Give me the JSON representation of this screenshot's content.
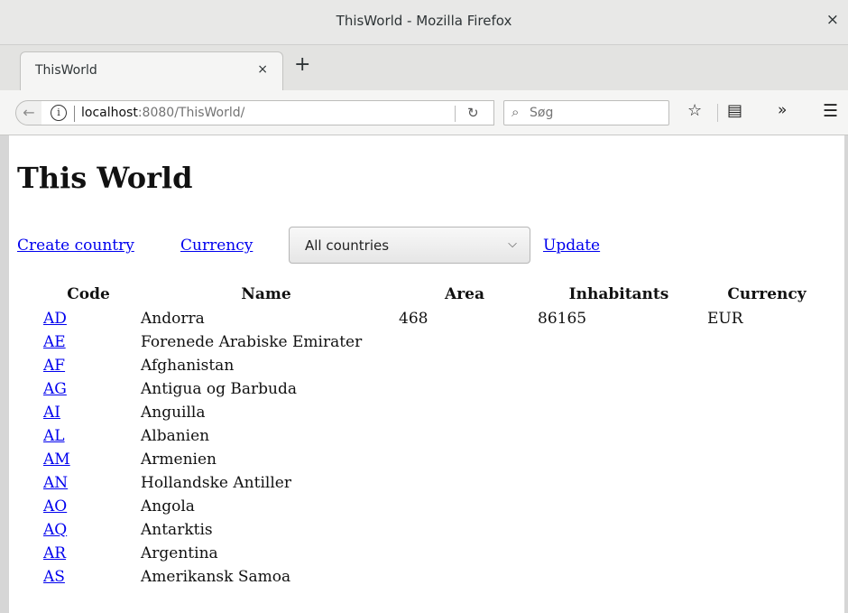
{
  "window": {
    "title": "ThisWorld - Mozilla Firefox",
    "close_glyph": "×"
  },
  "tabs": [
    {
      "label": "ThisWorld",
      "close_glyph": "×"
    }
  ],
  "new_tab_glyph": "+",
  "address_bar": {
    "host": "localhost",
    "rest": ":8080/ThisWorld/"
  },
  "search": {
    "placeholder": "Søg"
  },
  "page": {
    "title": "This World",
    "links": {
      "create_country": "Create country",
      "currency": "Currency",
      "update": "Update"
    },
    "country_filter": {
      "selected": "All countries"
    },
    "table": {
      "headers": {
        "code": "Code",
        "name": "Name",
        "area": "Area",
        "inhabitants": "Inhabitants",
        "currency": "Currency"
      },
      "rows": [
        {
          "code": "AD",
          "name": "Andorra",
          "area": "468",
          "inhabitants": "86165",
          "currency": "EUR"
        },
        {
          "code": "AE",
          "name": "Forenede Arabiske Emirater",
          "area": "",
          "inhabitants": "",
          "currency": ""
        },
        {
          "code": "AF",
          "name": "Afghanistan",
          "area": "",
          "inhabitants": "",
          "currency": ""
        },
        {
          "code": "AG",
          "name": "Antigua og Barbuda",
          "area": "",
          "inhabitants": "",
          "currency": ""
        },
        {
          "code": "AI",
          "name": "Anguilla",
          "area": "",
          "inhabitants": "",
          "currency": ""
        },
        {
          "code": "AL",
          "name": "Albanien",
          "area": "",
          "inhabitants": "",
          "currency": ""
        },
        {
          "code": "AM",
          "name": "Armenien",
          "area": "",
          "inhabitants": "",
          "currency": ""
        },
        {
          "code": "AN",
          "name": "Hollandske Antiller",
          "area": "",
          "inhabitants": "",
          "currency": ""
        },
        {
          "code": "AO",
          "name": "Angola",
          "area": "",
          "inhabitants": "",
          "currency": ""
        },
        {
          "code": "AQ",
          "name": "Antarktis",
          "area": "",
          "inhabitants": "",
          "currency": ""
        },
        {
          "code": "AR",
          "name": "Argentina",
          "area": "",
          "inhabitants": "",
          "currency": ""
        },
        {
          "code": "AS",
          "name": "Amerikansk Samoa",
          "area": "",
          "inhabitants": "",
          "currency": ""
        }
      ]
    }
  }
}
